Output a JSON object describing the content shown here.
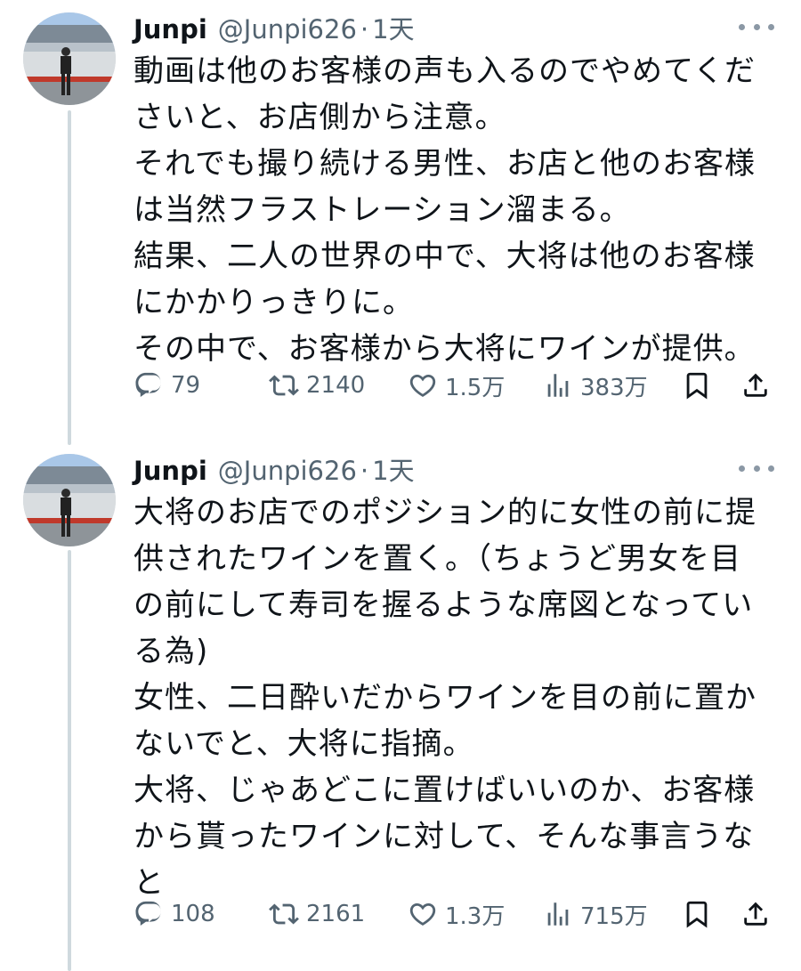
{
  "tweets": [
    {
      "author": {
        "name": "Junpi",
        "handle": "@Junpi626",
        "separator": "·",
        "time": "1天"
      },
      "lines": [
        "動画は他のお客様の声も入るのでやめてくだ",
        "さいと、お店側から注意。",
        "それでも撮り続ける男性、お店と他のお客様",
        "は当然フラストレーション溜まる。",
        "結果、二人の世界の中で、大将は他のお客様",
        "にかかりっきりに。",
        "その中で、お客様から大将にワインが提供。"
      ],
      "stats": {
        "replies": "79",
        "retweets": "2140",
        "likes": "1.5万",
        "views": "383万"
      }
    },
    {
      "author": {
        "name": "Junpi",
        "handle": "@Junpi626",
        "separator": "·",
        "time": "1天"
      },
      "lines": [
        "大将のお店でのポジション的に女性の前に提",
        "供されたワインを置く。（ちょうど男女を目",
        "の前にして寿司を握るような席図となってい",
        "る為)",
        "女性、二日酔いだからワインを目の前に置か",
        "ないでと、大将に指摘。",
        "大将、じゃあどこに置けばいいのか、お客様",
        "から貰ったワインに対して、そんな事言うな",
        "と"
      ],
      "stats": {
        "replies": "108",
        "retweets": "2161",
        "likes": "1.3万",
        "views": "715万"
      }
    }
  ],
  "icons": {
    "reply": "reply-icon",
    "retweet": "retweet-icon",
    "like": "heart-icon",
    "views": "views-icon",
    "bookmark": "bookmark-icon",
    "share": "share-icon",
    "more": "more-icon"
  },
  "colors": {
    "text": "#0f1419",
    "secondary": "#536471",
    "thread_line": "#cfd9de"
  }
}
